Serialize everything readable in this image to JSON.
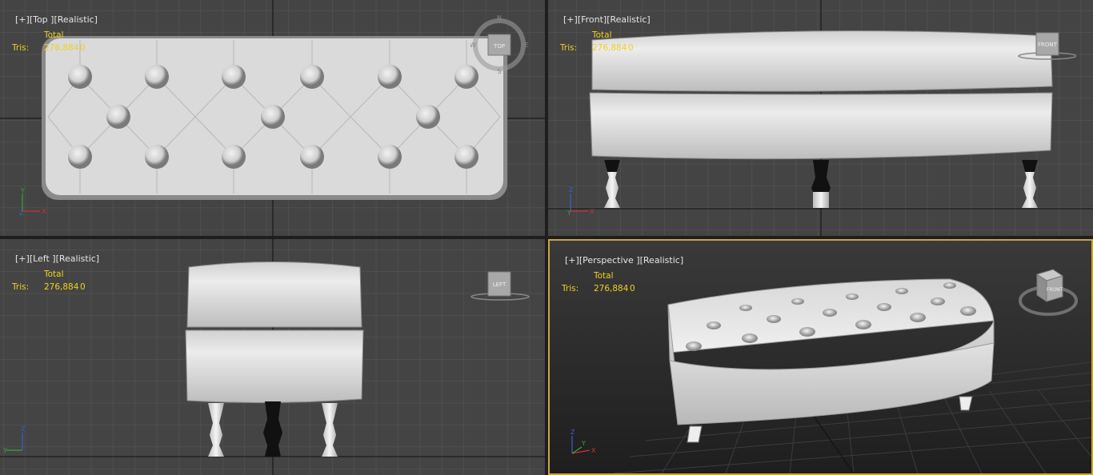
{
  "viewports": [
    {
      "id": "top",
      "plus": "[+]",
      "view": "[Top ]",
      "shade": "[Realistic]",
      "active": false,
      "cube_label": "TOP"
    },
    {
      "id": "front",
      "plus": "[+]",
      "view": "[Front]",
      "shade": "[Realistic]",
      "active": false,
      "cube_label": "FRONT"
    },
    {
      "id": "left",
      "plus": "[+]",
      "view": "[Left ]",
      "shade": "[Realistic]",
      "active": false,
      "cube_label": "LEFT"
    },
    {
      "id": "persp",
      "plus": "[+]",
      "view": "[Perspective ]",
      "shade": "[Realistic]",
      "active": true,
      "cube_label": "FRONT"
    }
  ],
  "stats": {
    "total_label": "Total",
    "tris_label": "Tris:",
    "tris_value": "276,884",
    "tris_selected": "0"
  },
  "compass": {
    "n": "N",
    "s": "S",
    "e": "E",
    "w": "W"
  },
  "axes": {
    "x": "X",
    "y": "Y",
    "z": "Z"
  },
  "colors": {
    "stats_text": "#f0d020",
    "active_border": "#c8a640",
    "viewport_bg": "#444444",
    "grid": "#555555"
  }
}
